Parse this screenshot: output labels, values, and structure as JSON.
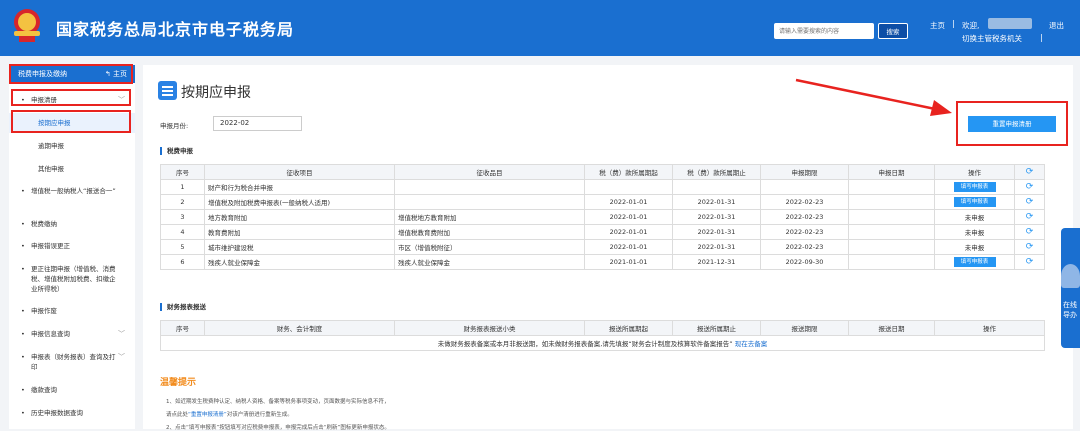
{
  "header": {
    "site_title": "国家税务总局北京市电子税务局",
    "search_placeholder": "请输入需要搜索的内容",
    "search_button": "搜索",
    "home_link": "主页",
    "separator": "|",
    "welcome": "欢迎,",
    "switch_role": "切换主管税务机关",
    "bar": "|",
    "exit": "退出"
  },
  "sidebar": {
    "top_label": "税费申报及缴纳",
    "top_home": "主页",
    "sections": [
      {
        "label": "申报清册",
        "dot": "•",
        "chevron": "﹀"
      },
      {
        "label": "增值税一般纳税人“报送合一”",
        "dot": "•"
      },
      {
        "label": "税费缴纳",
        "dot": "•"
      },
      {
        "label": "申报错误更正",
        "dot": "•"
      },
      {
        "label": "更正往期申报（增值税、消费税、增值税附加税费、扣缴企业所得税）",
        "dot": "•"
      },
      {
        "label": "申报作废",
        "dot": "•"
      },
      {
        "label": "申报信息查询",
        "dot": "•",
        "chevron": "﹀"
      },
      {
        "label": "申报表（财务报表）查询及打印",
        "dot": "•",
        "chevron": "﹀"
      },
      {
        "label": "缴款查询",
        "dot": "•"
      },
      {
        "label": "历史申报数据查询",
        "dot": "•"
      }
    ],
    "sub_items": [
      "按期应申报",
      "逾期申报",
      "其他申报"
    ]
  },
  "main": {
    "title": "按期应申报",
    "period_label": "申报月份:",
    "period_value": "2022-02",
    "reset_button": "重置申报清册",
    "tax_section_title": "税费申报",
    "tax_headers": [
      "序号",
      "征收项目",
      "征收品目",
      "税（费）款所属期起",
      "税（费）款所属期止",
      "申报期限",
      "申报日期",
      "操作"
    ],
    "tax_rows": [
      {
        "no": "1",
        "item": "财产和行为税合并申报",
        "sub": "",
        "start": "",
        "end": "",
        "deadline": "",
        "date": "",
        "op": "填写申报表",
        "op_type": "button"
      },
      {
        "no": "2",
        "item": "增值税及附加税费申报表(一般纳税人适用)",
        "sub": "",
        "start": "2022-01-01",
        "end": "2022-01-31",
        "deadline": "2022-02-23",
        "date": "",
        "op": "填写申报表",
        "op_type": "button"
      },
      {
        "no": "3",
        "item": "地方教育附加",
        "sub": "增值税地方教育附加",
        "start": "2022-01-01",
        "end": "2022-01-31",
        "deadline": "2022-02-23",
        "date": "",
        "op": "未申报",
        "op_type": "text"
      },
      {
        "no": "4",
        "item": "教育费附加",
        "sub": "增值税教育费附加",
        "start": "2022-01-01",
        "end": "2022-01-31",
        "deadline": "2022-02-23",
        "date": "",
        "op": "未申报",
        "op_type": "text"
      },
      {
        "no": "5",
        "item": "城市维护建设税",
        "sub": "市区（增值税附征）",
        "start": "2022-01-01",
        "end": "2022-01-31",
        "deadline": "2022-02-23",
        "date": "",
        "op": "未申报",
        "op_type": "text"
      },
      {
        "no": "6",
        "item": "残疾人就业保障金",
        "sub": "残疾人就业保障金",
        "start": "2021-01-01",
        "end": "2021-12-31",
        "deadline": "2022-09-30",
        "date": "",
        "op": "填写申报表",
        "op_type": "button"
      }
    ],
    "fin_section_title": "财务报表报送",
    "fin_headers": [
      "序号",
      "财务、会计制度",
      "财务报表报送小类",
      "报送所属期起",
      "报送所属期止",
      "报送期限",
      "报送日期",
      "操作"
    ],
    "fin_note": "未做财务报表备案或本月非报送期，如未做财务报表备案,请先填报“财务会计制度及核算软件备案报告”",
    "fin_note_link": "现在去备案",
    "tips_title": "温馨提示",
    "tips": [
      {
        "text": "1、如近期发生税费种认定、纳税人资格、备案等税务事项变动，页面数据与实际信息不符，",
        "link": ""
      },
      {
        "text": "请点此处",
        "link": "“重置申报清册”",
        "after": "对该户清册进行重新生成。"
      },
      {
        "text": "2、点击“填写申报表”按钮填写对应税费申报表，申报完成后点击“刷新”图标更新申报状态。",
        "link": ""
      }
    ],
    "refresh_icon": "refresh-icon"
  },
  "float_help": {
    "label": "在线导办"
  },
  "colors": {
    "header_blue": "#1a6fd0",
    "button_blue": "#2596f3",
    "annotation_red": "#e8231f",
    "tip_orange": "#f28c1e"
  }
}
